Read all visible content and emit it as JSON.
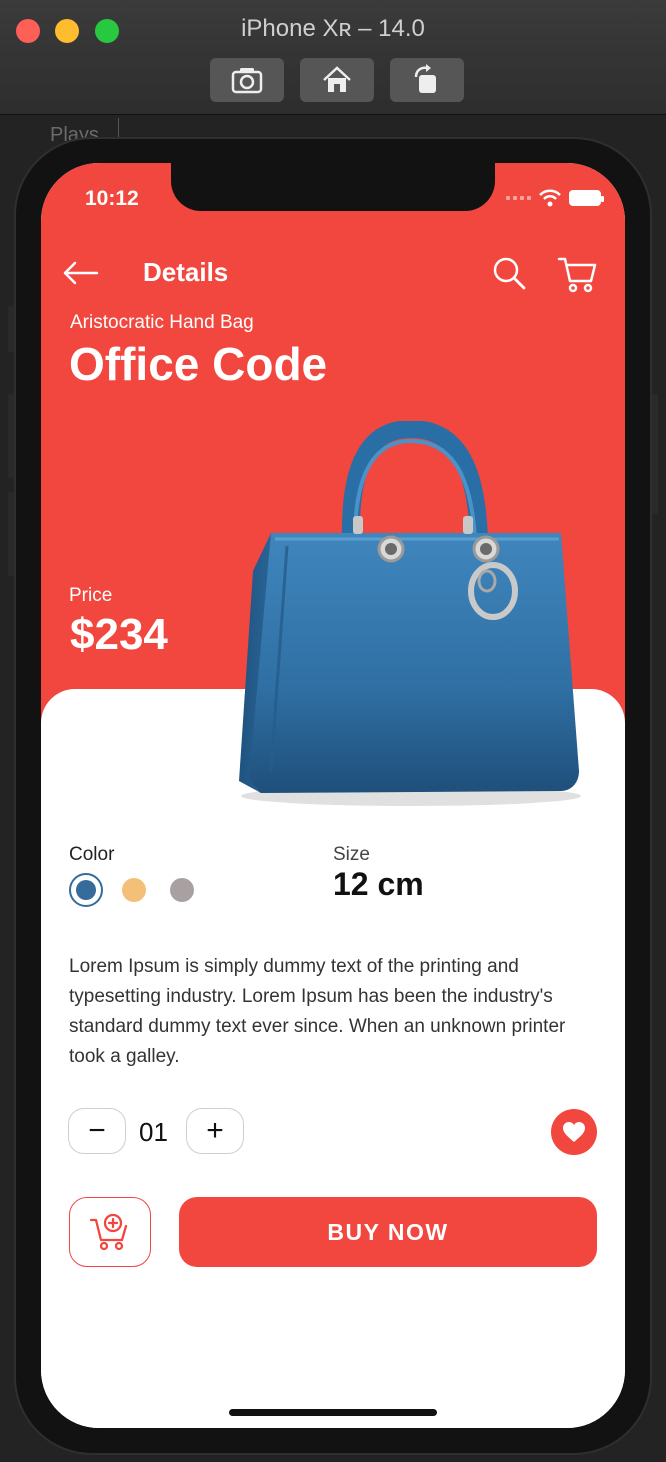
{
  "simulator": {
    "title": "iPhone Xʀ – 14.0",
    "toolbar": [
      "screenshot-icon",
      "home-icon",
      "rotate-icon"
    ],
    "background_text": "Plays"
  },
  "status_bar": {
    "time": "10:12"
  },
  "app_bar": {
    "title": "Details",
    "icons": [
      "back-arrow-icon",
      "search-icon",
      "cart-icon"
    ]
  },
  "product": {
    "subtitle": "Aristocratic Hand Bag",
    "title": "Office Code",
    "price_label": "Price",
    "price": "$234",
    "color_label": "Color",
    "colors": [
      {
        "name": "blue",
        "hex": "#356c9c",
        "selected": true
      },
      {
        "name": "orange",
        "hex": "#f4c078",
        "selected": false
      },
      {
        "name": "gray",
        "hex": "#a9a1a1",
        "selected": false
      }
    ],
    "size_label": "Size",
    "size": "12 cm",
    "description": "Lorem Ipsum is simply dummy text of the printing and typesetting industry. Lorem Ipsum has been the industry's standard dummy text ever since. When an unknown printer took a galley."
  },
  "quantity": {
    "minus": "−",
    "value": "01",
    "plus": "+"
  },
  "actions": {
    "buy_label": "BUY  NOW",
    "add_to_cart_icon": "add-to-cart-icon",
    "favorite_icon": "heart-icon"
  },
  "theme": {
    "accent": "#f2473f"
  }
}
